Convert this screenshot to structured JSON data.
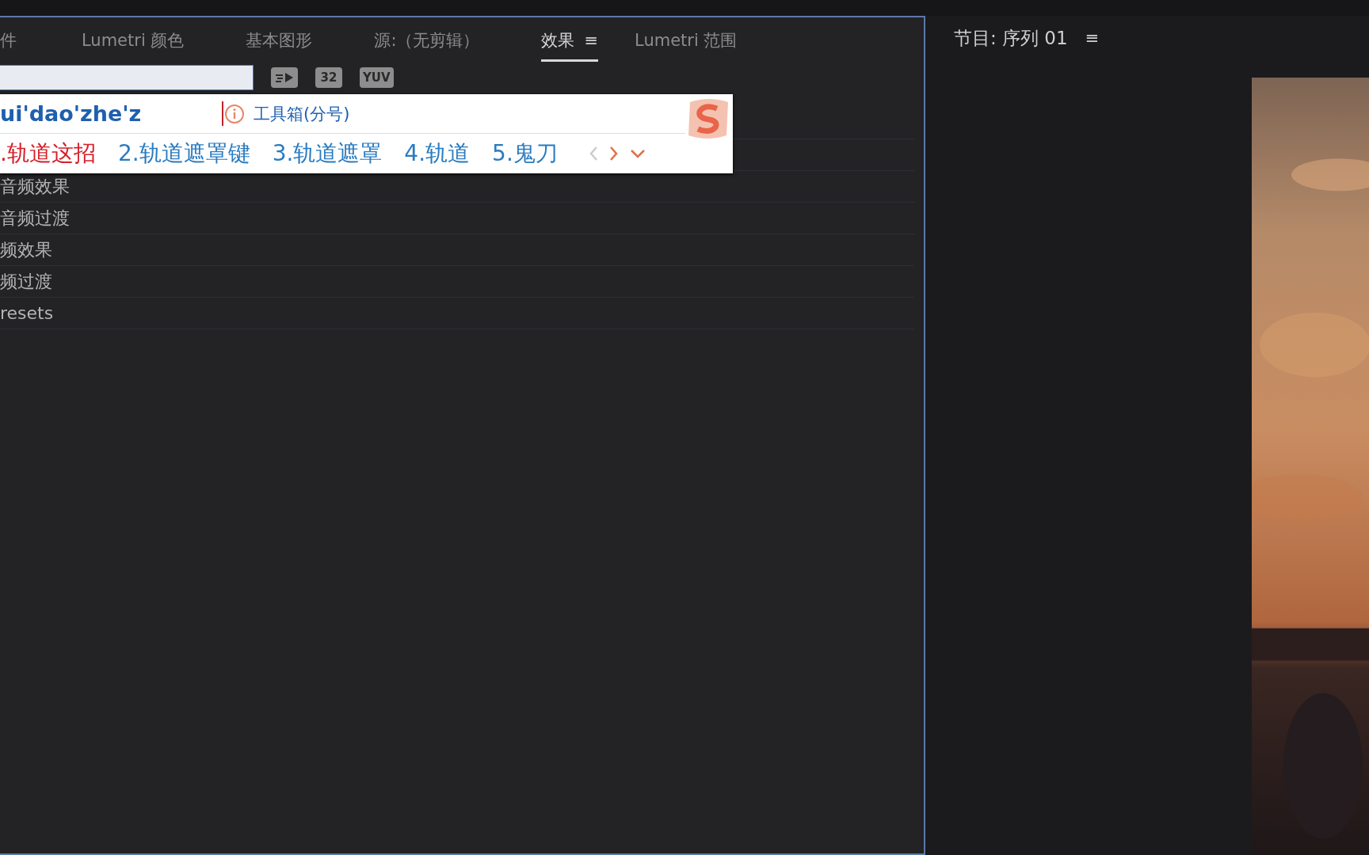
{
  "effects_panel": {
    "tabs": [
      {
        "label": "件",
        "selected": false
      },
      {
        "label": "Lumetri 颜色",
        "selected": false
      },
      {
        "label": "基本图形",
        "selected": false
      },
      {
        "label": "源:（无剪辑）",
        "selected": false
      },
      {
        "label": "效果",
        "selected": true,
        "menu": "≡"
      },
      {
        "label": "Lumetri 范围",
        "selected": false
      }
    ],
    "toolbar_icons": [
      {
        "kind": "accelerated"
      },
      {
        "kind": "badge",
        "label": "32"
      },
      {
        "kind": "badge",
        "label": "YUV"
      }
    ],
    "items": [
      "音频效果",
      "音频过渡",
      "频效果",
      "频过渡",
      "resets"
    ]
  },
  "ime_popup": {
    "composition": "ui'dao'zhe'z",
    "hint": "工具箱(分号)",
    "candidates": [
      {
        "label": ".轨道这招",
        "selected": true
      },
      {
        "label": "2.轨道遮罩键",
        "selected": false
      },
      {
        "label": "3.轨道遮罩",
        "selected": false
      },
      {
        "label": "4.轨道",
        "selected": false
      },
      {
        "label": "5.鬼刀",
        "selected": false
      }
    ]
  },
  "program_monitor": {
    "title": "节目: 序列 01",
    "menu": "≡"
  }
}
